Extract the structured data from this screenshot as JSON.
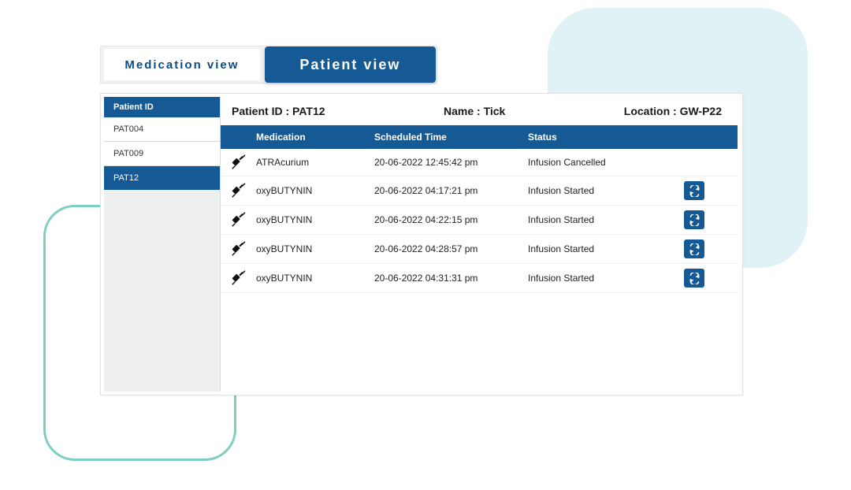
{
  "tabs": {
    "inactive": "Medication view",
    "active": "Patient view"
  },
  "sidebar": {
    "header": "Patient ID",
    "items": [
      {
        "id": "PAT004",
        "selected": false
      },
      {
        "id": "PAT009",
        "selected": false
      },
      {
        "id": "PAT12",
        "selected": true
      }
    ]
  },
  "info": {
    "patient_id_label": "Patient ID :",
    "patient_id_value": "PAT12",
    "name_label": "Name :",
    "name_value": "Tick",
    "location_label": "Location :",
    "location_value": "GW-P22"
  },
  "table": {
    "headers": {
      "medication": "Medication",
      "scheduled_time": "Scheduled Time",
      "status": "Status"
    },
    "rows": [
      {
        "medication": "ATRAcurium",
        "time": "20-06-2022 12:45:42 pm",
        "status": "Infusion Cancelled",
        "has_refresh": false
      },
      {
        "medication": "oxyBUTYNIN",
        "time": "20-06-2022 04:17:21 pm",
        "status": "Infusion Started",
        "has_refresh": true
      },
      {
        "medication": "oxyBUTYNIN",
        "time": "20-06-2022 04:22:15 pm",
        "status": "Infusion Started",
        "has_refresh": true
      },
      {
        "medication": "oxyBUTYNIN",
        "time": "20-06-2022 04:28:57 pm",
        "status": "Infusion Started",
        "has_refresh": true
      },
      {
        "medication": "oxyBUTYNIN",
        "time": "20-06-2022 04:31:31 pm",
        "status": "Infusion Started",
        "has_refresh": true
      }
    ]
  },
  "colors": {
    "primary": "#155a94",
    "decoration_teal_fill": "#e0f2f5",
    "decoration_teal_border": "#7ecfc0"
  }
}
